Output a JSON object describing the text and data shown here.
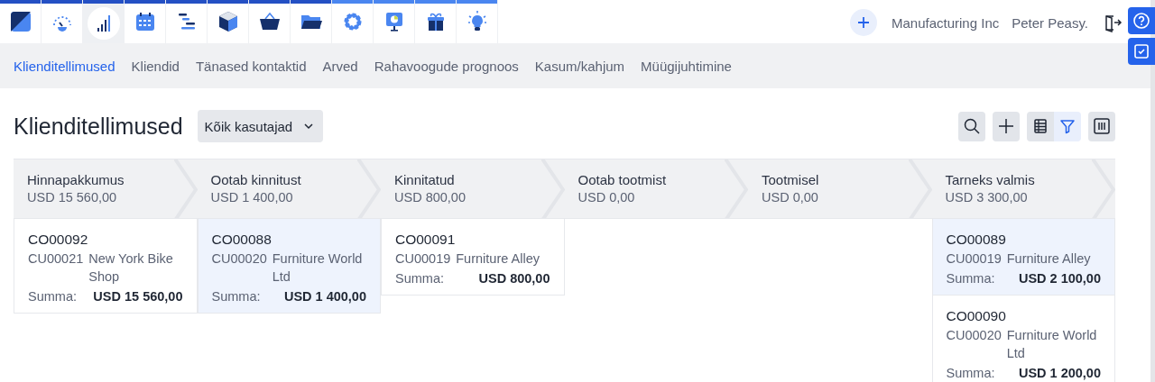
{
  "modules": [
    {
      "selected": false,
      "color": "#2450c4"
    },
    {
      "selected": false,
      "color": "#2450c4"
    },
    {
      "selected": true,
      "color": "#2450c4"
    },
    {
      "selected": false,
      "color": "#2450c4"
    },
    {
      "selected": false,
      "color": "#2450c4"
    },
    {
      "selected": false,
      "color": "#2450c4"
    },
    {
      "selected": false,
      "color": "#2450c4"
    },
    {
      "selected": false,
      "color": "#2450c4"
    },
    {
      "selected": false,
      "color": "#4a86f0"
    },
    {
      "selected": false,
      "color": "#4a86f0"
    },
    {
      "selected": false,
      "color": "#4a86f0"
    },
    {
      "selected": false,
      "color": "#4a86f0"
    }
  ],
  "header": {
    "company": "Manufacturing Inc",
    "user": "Peter Peasy."
  },
  "tabs": [
    {
      "label": "Klienditellimused",
      "selected": true
    },
    {
      "label": "Kliendid",
      "selected": false
    },
    {
      "label": "Tänased kontaktid",
      "selected": false
    },
    {
      "label": "Arved",
      "selected": false
    },
    {
      "label": "Rahavoogude prognoos",
      "selected": false
    },
    {
      "label": "Kasum/kahjum",
      "selected": false
    },
    {
      "label": "Müügijuhtimine",
      "selected": false
    }
  ],
  "page": {
    "title": "Klienditellimused",
    "filter": "Kõik kasutajad"
  },
  "view_toggle": [
    {
      "kind": "table",
      "selected": false
    },
    {
      "kind": "filter",
      "selected": true
    }
  ],
  "columns": [
    {
      "title": "Hinnapakkumus",
      "total": "USD 15 560,00",
      "cards": [
        {
          "order": "CO00092",
          "customer_code": "CU00021",
          "customer_name": "New York Bike Shop",
          "sum_label": "Summa:",
          "amount": "USD 15 560,00",
          "selected": false
        }
      ]
    },
    {
      "title": "Ootab kinnitust",
      "total": "USD 1 400,00",
      "cards": [
        {
          "order": "CO00088",
          "customer_code": "CU00020",
          "customer_name": "Furniture World Ltd",
          "sum_label": "Summa:",
          "amount": "USD 1 400,00",
          "selected": true
        }
      ]
    },
    {
      "title": "Kinnitatud",
      "total": "USD 800,00",
      "cards": [
        {
          "order": "CO00091",
          "customer_code": "CU00019",
          "customer_name": "Furniture Alley",
          "sum_label": "Summa:",
          "amount": "USD 800,00",
          "selected": false
        }
      ]
    },
    {
      "title": "Ootab tootmist",
      "total": "USD 0,00"
    },
    {
      "title": "Tootmisel",
      "total": "USD 0,00"
    },
    {
      "title": "Tarneks valmis",
      "total": "USD 3 300,00",
      "cards": [
        {
          "order": "CO00089",
          "customer_code": "CU00019",
          "customer_name": "Furniture Alley",
          "sum_label": "Summa:",
          "amount": "USD 2 100,00",
          "selected": true
        },
        {
          "order": "CO00090",
          "customer_code": "CU00020",
          "customer_name": "Furniture World Ltd",
          "sum_label": "Summa:",
          "amount": "USD 1 200,00",
          "selected": false
        }
      ]
    }
  ]
}
